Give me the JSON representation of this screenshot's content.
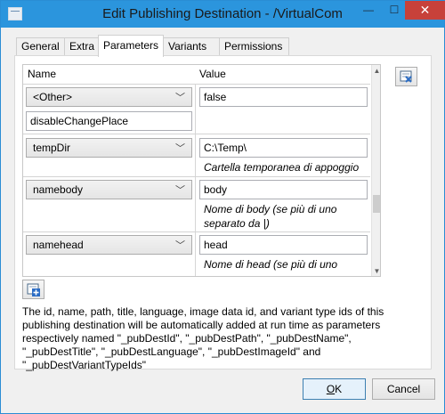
{
  "window": {
    "title": "Edit Publishing Destination - /VirtualCom",
    "minimize_glyph": "—",
    "maximize_glyph": "☐",
    "close_glyph": "✕"
  },
  "tabs": [
    {
      "label": "General"
    },
    {
      "label": "Extra"
    },
    {
      "label": "Parameters"
    },
    {
      "label": "Variants"
    },
    {
      "label": "Permissions"
    }
  ],
  "grid": {
    "col_name": "Name",
    "col_value": "Value",
    "rows": [
      {
        "name": "<Other>",
        "custom_name": "disableChangePlace",
        "value": "false",
        "description": ""
      },
      {
        "name": "tempDir",
        "value": "C:\\Temp\\",
        "description": "Cartella temporanea di appoggio"
      },
      {
        "name": "namebody",
        "value": "body",
        "description": "Nome di body (se più di uno separato da |)"
      },
      {
        "name": "namehead",
        "value": "head",
        "description": "Nome di head (se più di uno"
      }
    ]
  },
  "info_text": "The id, name, path, title, language, image data id, and variant type ids of this publishing destination will be automatically added at run time as parameters respectively named \"_pubDestId\", \"_pubDestPath\", \"_pubDestName\", \"_pubDestTitle\", \"_pubDestLanguage\", \"_pubDestImageId\" and \"_pubDestVariantTypeIds\"",
  "buttons": {
    "ok_mnemonic": "O",
    "ok_rest": "K",
    "cancel": "Cancel"
  },
  "icons": {
    "remove_param": "remove-parameter-icon",
    "add_param": "add-parameter-icon",
    "combo_chevron": "chevron-down-icon"
  },
  "colors": {
    "titlebar": "#2b95dd",
    "close_button": "#c7413a"
  }
}
